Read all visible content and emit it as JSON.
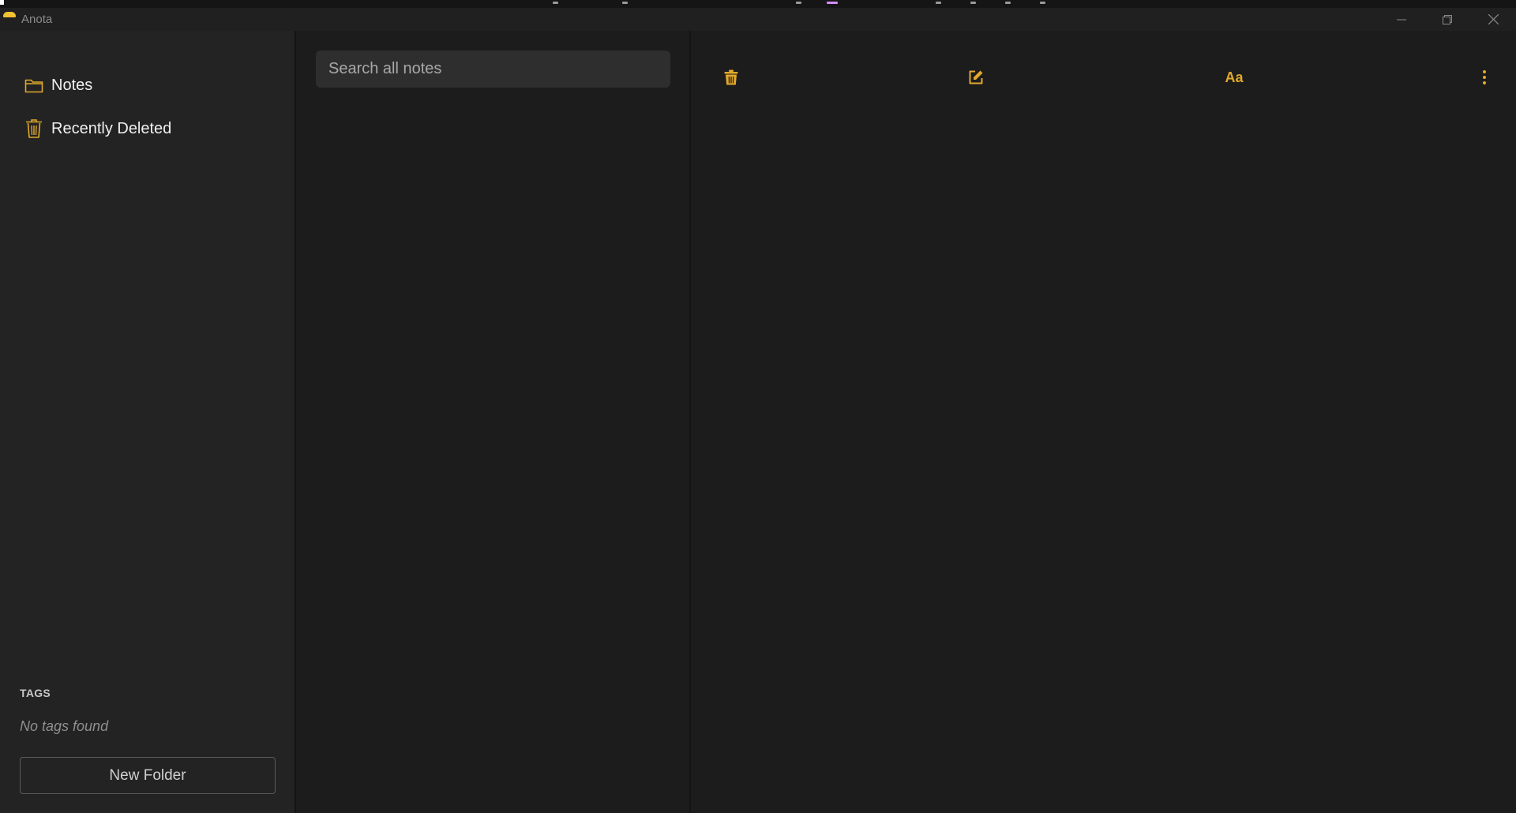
{
  "window": {
    "title": "Anota"
  },
  "sidebar": {
    "items": [
      {
        "label": "Notes",
        "icon": "folder-icon"
      },
      {
        "label": "Recently Deleted",
        "icon": "trash-icon"
      }
    ],
    "tags_heading": "TAGS",
    "tags_empty": "No tags found",
    "new_folder_label": "New Folder"
  },
  "notes_list": {
    "search_placeholder": "Search all notes"
  },
  "editor_toolbar": {
    "format_label": "Aa",
    "icons": [
      "trash-icon",
      "compose-icon",
      "format-icon",
      "more-vertical-icon"
    ]
  },
  "colors": {
    "accent": "#e2a92b",
    "background": "#1c1c1c",
    "sidebar": "#232323"
  }
}
